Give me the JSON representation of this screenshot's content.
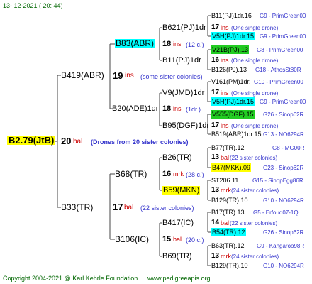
{
  "header": {
    "date": "13- 12-2021 ( 20: 44)"
  },
  "colors": {
    "yellow": "#ffff00",
    "cyan": "#00ffff",
    "green": "#22cc22",
    "line": "#444444"
  },
  "root": {
    "label": "B2.79(JtB)",
    "count": "20",
    "mark": "bal",
    "note": "(Drones from 20 sister colonies)"
  },
  "gen1": [
    {
      "label": "B419(ABR)",
      "count": "19",
      "mark": "ins",
      "info": "(some sister colonies)"
    },
    {
      "label": "B33(TR)",
      "count": "17",
      "mark": "bal",
      "info": "(22 sister colonies)"
    }
  ],
  "gen2": [
    {
      "label": "B83(ABR)",
      "count": "18",
      "mark": "ins",
      "info": "(12 c.)"
    },
    {
      "label": "B20(ADE)1dr",
      "count": "18",
      "mark": "ins",
      "info": "(1dr.)"
    },
    {
      "label": "B68(TR)",
      "count": "16",
      "mark": "mrk",
      "info": "(28 c.)"
    },
    {
      "label": "B106(IC)",
      "count": "15",
      "mark": "bal",
      "info": "(20 c.)"
    }
  ],
  "gen3": [
    {
      "label": "B621(PJ)1dr",
      "count": "17",
      "mark": "ins",
      "info": "(One single drone)"
    },
    {
      "label": "B11(PJ)1dr",
      "count": "16",
      "mark": "ins",
      "info": "(One single drone)"
    },
    {
      "label": "V9(JMD)1dr",
      "count": "17",
      "mark": "ins",
      "info": "(One single drone)"
    },
    {
      "label": "B95(DGF)1dr",
      "count": "17",
      "mark": "ins",
      "info": "(One single drone)"
    },
    {
      "label": "B26(TR)",
      "count": "13",
      "mark": "bal",
      "info": "(22 sister colonies)"
    },
    {
      "label": "B59(MKN)",
      "count": "13",
      "mark": "mrk",
      "info": "(24 sister colonies)"
    },
    {
      "label": "B417(IC)",
      "count": "14",
      "mark": "bal",
      "info": "(22 sister colonies)"
    },
    {
      "label": "B69(TR)",
      "count": "13",
      "mark": "mrk",
      "info": "(24 sister colonies)"
    }
  ],
  "gen4": [
    {
      "label": "B11(PJ)1dr.16",
      "info": "G9 - PrimGreen00"
    },
    {
      "label": "V5H(PJ)1dr.15",
      "info": "G9 - PrimGreen00"
    },
    {
      "label": "V21B(PJ).13",
      "info": "G8 - PrimGreen00"
    },
    {
      "label": "B126(PJ).13",
      "info": "G18 - AthosSt80R"
    },
    {
      "label": "V161(PM)1dr.",
      "info": "G10 - PrimGreen00"
    },
    {
      "label": "V5H(PJ)1dr.15",
      "info": "G9 - PrimGreen00"
    },
    {
      "label": "V555(DGF).15",
      "info": "G26 - Sinop62R"
    },
    {
      "label": "B519(ABR)1dr.15",
      "info": "G13 - NO6294R"
    },
    {
      "label": "B77(TR).12",
      "info": "G8 - MG00R"
    },
    {
      "label": "B47(MKK).09",
      "info": "G23 - Sinop62R"
    },
    {
      "label": "ST206.11",
      "info": "G15 - SinopEgg86R"
    },
    {
      "label": "B129(TR).10",
      "info": "G10 - NO6294R"
    },
    {
      "label": "B17(TR).13",
      "info": "G5 - Erfoud07-1Q"
    },
    {
      "label": "B54(TR).12",
      "info": "G26 - Sinop62R"
    },
    {
      "label": "B63(TR).12",
      "info": "G9 - Kangaroo98R"
    },
    {
      "label": "B129(TR).10",
      "info": "G10 - NO6294R"
    }
  ],
  "footer": {
    "copyright": "Copyright 2004-2021 @ Karl Kehrle Foundation",
    "site": "www.pedigreeapis.org"
  }
}
